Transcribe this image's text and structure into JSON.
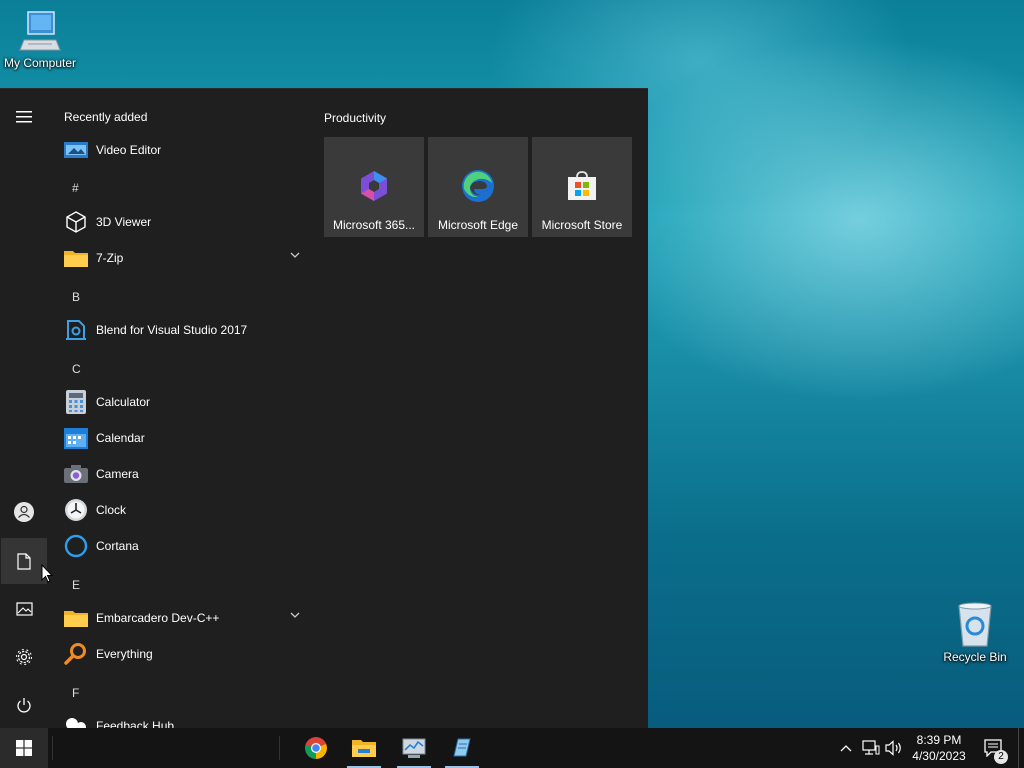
{
  "desktop": {
    "icons": [
      {
        "label": "My Computer",
        "icon": "computer-icon"
      },
      {
        "label": "Recycle Bin",
        "icon": "recycle-bin-icon"
      }
    ]
  },
  "start_menu": {
    "app_list": {
      "header": "Recently added",
      "items": [
        {
          "label": "Video Editor",
          "icon": "video-editor-icon"
        },
        {
          "letter": "#"
        },
        {
          "label": "3D Viewer",
          "icon": "cube-icon"
        },
        {
          "label": "7-Zip",
          "icon": "folder-icon",
          "expandable": true
        },
        {
          "letter": "B"
        },
        {
          "label": "Blend for Visual Studio 2017",
          "icon": "blend-icon"
        },
        {
          "letter": "C"
        },
        {
          "label": "Calculator",
          "icon": "calculator-icon"
        },
        {
          "label": "Calendar",
          "icon": "calendar-icon"
        },
        {
          "label": "Camera",
          "icon": "camera-icon"
        },
        {
          "label": "Clock",
          "icon": "clock-icon"
        },
        {
          "label": "Cortana",
          "icon": "cortana-icon"
        },
        {
          "letter": "E"
        },
        {
          "label": "Embarcadero Dev-C++",
          "icon": "folder-icon",
          "expandable": true
        },
        {
          "label": "Everything",
          "icon": "magnifier-icon"
        },
        {
          "letter": "F"
        },
        {
          "label": "Feedback Hub",
          "icon": "feedback-hub-icon"
        }
      ]
    },
    "tiles": {
      "group_title": "Productivity",
      "items": [
        {
          "label": "Microsoft 365...",
          "icon": "microsoft-365-icon"
        },
        {
          "label": "Microsoft Edge",
          "icon": "edge-icon"
        },
        {
          "label": "Microsoft Store",
          "icon": "store-icon"
        }
      ]
    },
    "rail": [
      "hamburger-menu-icon",
      "user-icon",
      "documents-icon",
      "pictures-icon",
      "settings-icon",
      "power-icon"
    ]
  },
  "taskbar": {
    "apps": [
      "chrome-icon",
      "file-explorer-icon",
      "task-manager-icon",
      "notepad-icon"
    ],
    "clock": {
      "time": "8:39 PM",
      "date": "4/30/2023"
    },
    "notification_count": "2"
  },
  "colors": {
    "start_bg": "#1f1f1f",
    "tile_bg": "#3a3a3a",
    "taskbar_bg": "#141414",
    "accent": "#9ec1e6"
  }
}
